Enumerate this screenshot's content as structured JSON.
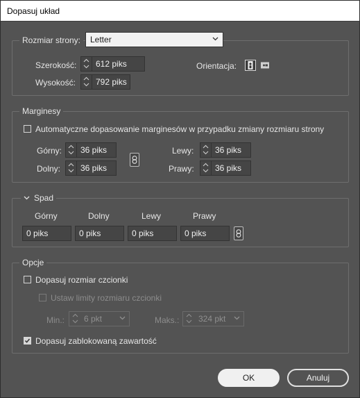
{
  "window": {
    "title": "Dopasuj układ"
  },
  "page_size": {
    "label": "Rozmiar strony:",
    "selected": "Letter",
    "width_label": "Szerokość:",
    "width_value": "612 piks",
    "height_label": "Wysokość:",
    "height_value": "792 piks",
    "orientation_label": "Orientacja:"
  },
  "margins": {
    "legend": "Marginesy",
    "auto_label": "Automatyczne dopasowanie marginesów w przypadku zmiany rozmiaru strony",
    "auto_checked": false,
    "top_label": "Górny:",
    "top_value": "36 piks",
    "bottom_label": "Dolny:",
    "bottom_value": "36 piks",
    "left_label": "Lewy:",
    "left_value": "36 piks",
    "right_label": "Prawy:",
    "right_value": "36 piks"
  },
  "bleed": {
    "legend": "Spad",
    "top_label": "Górny",
    "bottom_label": "Dolny",
    "left_label": "Lewy",
    "right_label": "Prawy",
    "top_value": "0 piks",
    "bottom_value": "0 piks",
    "left_value": "0 piks",
    "right_value": "0 piks"
  },
  "options": {
    "legend": "Opcje",
    "font_size_label": "Dopasuj rozmiar czcionki",
    "font_size_checked": false,
    "limits_label": "Ustaw limity rozmiaru czcionki",
    "limits_checked": false,
    "min_label": "Min.:",
    "min_value": "6 pkt",
    "max_label": "Maks.:",
    "max_value": "324 pkt",
    "locked_label": "Dopasuj zablokowaną zawartość",
    "locked_checked": true
  },
  "buttons": {
    "ok": "OK",
    "cancel": "Anuluj"
  },
  "colors": {
    "background": "#535353",
    "field": "#454545",
    "text": "#e6e6e6"
  }
}
